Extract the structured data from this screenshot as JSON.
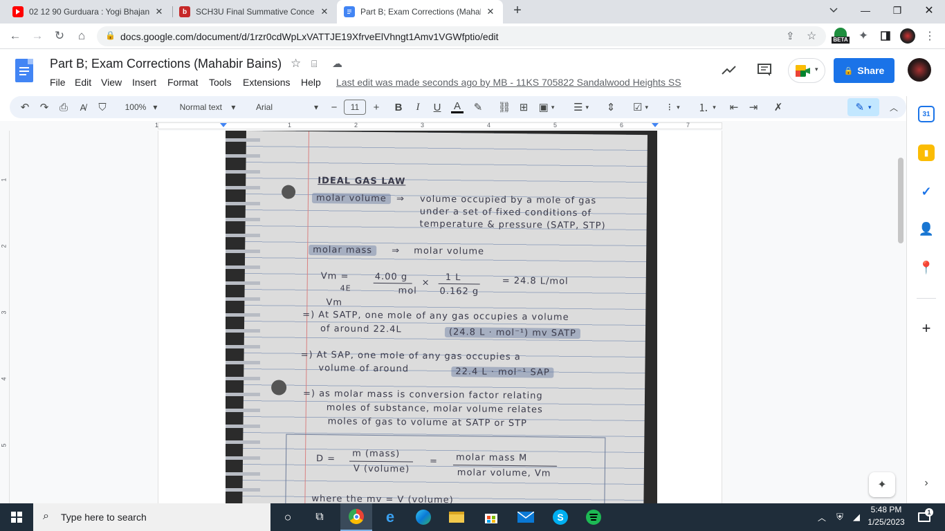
{
  "browser": {
    "tabs": [
      {
        "title": "02 12 90 Gurduara : Yogi Bhajan",
        "favicon": "youtube-icon",
        "color": "#ff0000"
      },
      {
        "title": "SCH3U Final Summative Concept",
        "favicon": "brightspace-icon",
        "color": "#c62828"
      },
      {
        "title": "Part B; Exam Corrections (Mahabir",
        "favicon": "google-docs-icon",
        "color": "#4285f4",
        "active": true
      }
    ],
    "new_tab": "+",
    "url": "docs.google.com/document/d/1rzr0cdWpLxVATTJE19XfrveElVhngt1Amv1VGWfptio/edit",
    "beta_badge": "BETA"
  },
  "doc": {
    "title": "Part B; Exam Corrections (Mahabir Bains)",
    "menus": [
      "File",
      "Edit",
      "View",
      "Insert",
      "Format",
      "Tools",
      "Extensions",
      "Help"
    ],
    "last_edit": "Last edit was made seconds ago by MB - 11KS 705822 Sandalwood Heights SS",
    "share_label": "Share"
  },
  "toolbar": {
    "zoom": "100%",
    "style": "Normal text",
    "font": "Arial",
    "font_size": "11",
    "minus": "−",
    "plus": "+"
  },
  "ruler": {
    "h_ticks": [
      "1",
      "1",
      "2",
      "3",
      "4",
      "5",
      "6",
      "7"
    ],
    "v_ticks": [
      "1",
      "2",
      "3",
      "4",
      "5"
    ]
  },
  "notes": {
    "heading": "IDEAL GAS LAW",
    "line1_label": "molar volume",
    "line1_text": "volume occupied by a mole of gas",
    "line2_text": "under a set of fixed conditions of",
    "line3_text": "temperature & pressure (SATP, STP)",
    "line4_label": "molar mass",
    "line4_text": "molar volume",
    "eq_lhs": "Vm =",
    "eq_n1": "4.00 g",
    "eq_d1": "mol",
    "eq_n2": "1 L",
    "eq_d2": "0.162 g",
    "eq_result": "= 24.8 L/mol",
    "eq_sub": "4E",
    "vm_label": "Vm",
    "p1a": "=) At  SATP, one mole of any gas occupies a volume",
    "p1b": "of  around 22.4L",
    "p1_hl": "(24.8 L · mol⁻¹) mv SATP",
    "p2a": "=) At  SAP, one mole of any gas occupies a",
    "p2b": "volume of around",
    "p2_hl": "22.4 L · mol⁻¹ SAP",
    "p3a": "=) as molar mass is conversion factor relating",
    "p3b": "moles of substance, molar volume relates",
    "p3c": "moles of gas to volume at SATP or STP",
    "f1_lhs": "D =",
    "f1_num": "m (mass)",
    "f1_den": "V (volume)",
    "f1_eq": "=",
    "f1_rnum": "molar mass M",
    "f1_rden": "molar volume, Vm",
    "last": "where the mv = V (volume)"
  },
  "taskbar": {
    "search_placeholder": "Type here to search",
    "time": "5:48 PM",
    "date": "1/25/2023",
    "notif_count": "1"
  }
}
